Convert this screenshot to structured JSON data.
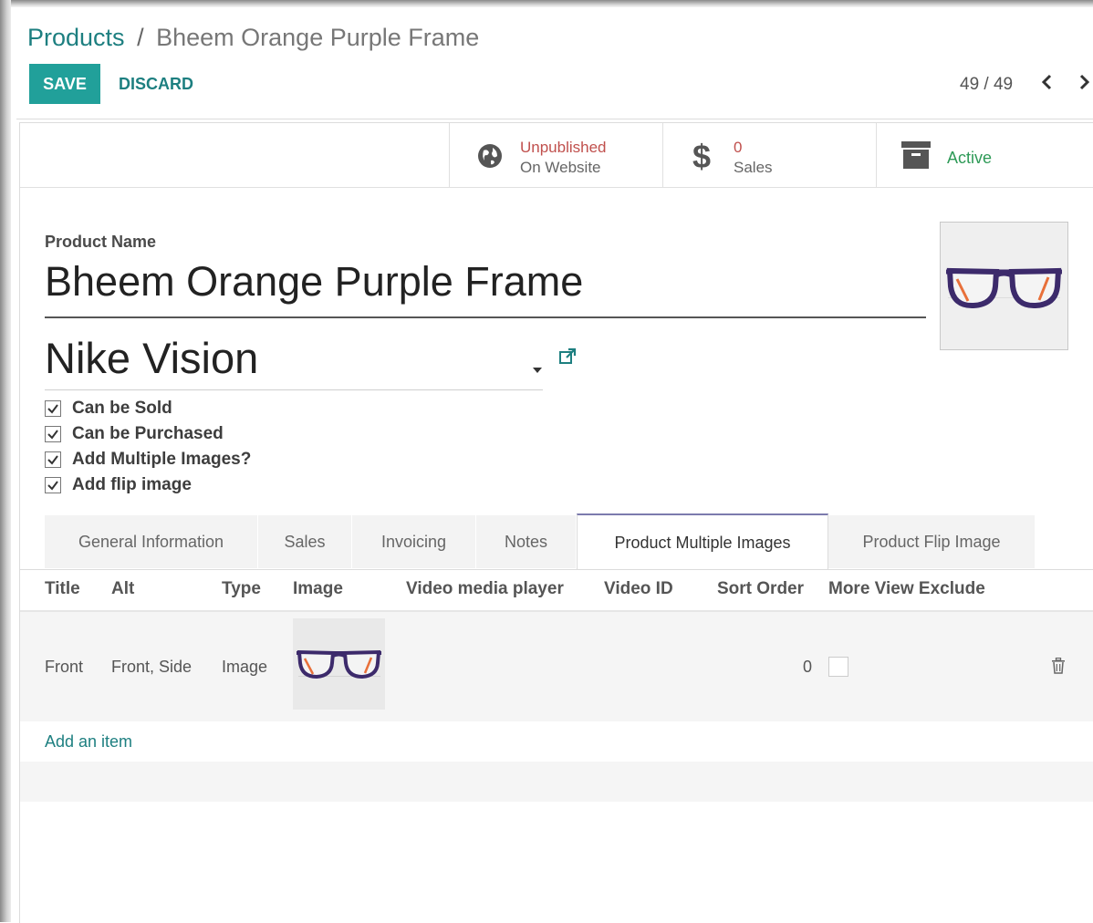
{
  "breadcrumb": {
    "parent": "Products",
    "separator": "/",
    "current": "Bheem Orange Purple Frame"
  },
  "toolbar": {
    "save_label": "SAVE",
    "discard_label": "DISCARD"
  },
  "pager": {
    "value": "49 / 49",
    "prev_icon": "chevron-left-icon",
    "next_icon": "chevron-right-icon"
  },
  "button_box": {
    "website": {
      "line1": "Unpublished",
      "line2": "On Website",
      "icon": "globe-icon",
      "color": "#c0504d"
    },
    "sales": {
      "line1": "0",
      "line2": "Sales",
      "icon": "dollar-icon"
    },
    "active": {
      "label": "Active",
      "icon": "archive-icon",
      "color": "#2e9a57"
    }
  },
  "form": {
    "product_name_label": "Product Name",
    "product_name": "Bheem Orange Purple Frame",
    "brand": "Nike Vision",
    "checkboxes": [
      {
        "label": "Can be Sold",
        "checked": true
      },
      {
        "label": "Can be Purchased",
        "checked": true
      },
      {
        "label": "Add Multiple Images?",
        "checked": true
      },
      {
        "label": "Add flip image",
        "checked": true
      }
    ]
  },
  "tabs": [
    {
      "label": "General Information",
      "active": false
    },
    {
      "label": "Sales",
      "active": false
    },
    {
      "label": "Invoicing",
      "active": false
    },
    {
      "label": "Notes",
      "active": false
    },
    {
      "label": "Product Multiple Images",
      "active": true
    },
    {
      "label": "Product Flip Image",
      "active": false
    }
  ],
  "table": {
    "headers": [
      "Title",
      "Alt",
      "Type",
      "Image",
      "Video media player",
      "Video ID",
      "Sort Order",
      "More View Exclude"
    ],
    "rows": [
      {
        "title": "Front",
        "alt": "Front, Side",
        "type": "Image",
        "image": "glasses-thumbnail",
        "video_player": "",
        "video_id": "",
        "sort_order": "0",
        "more_view_exclude": false
      }
    ],
    "add_item_label": "Add an item"
  },
  "colors": {
    "accent": "#21a09a",
    "link": "#1d7f80",
    "tab_active_border": "#7c7bad"
  }
}
